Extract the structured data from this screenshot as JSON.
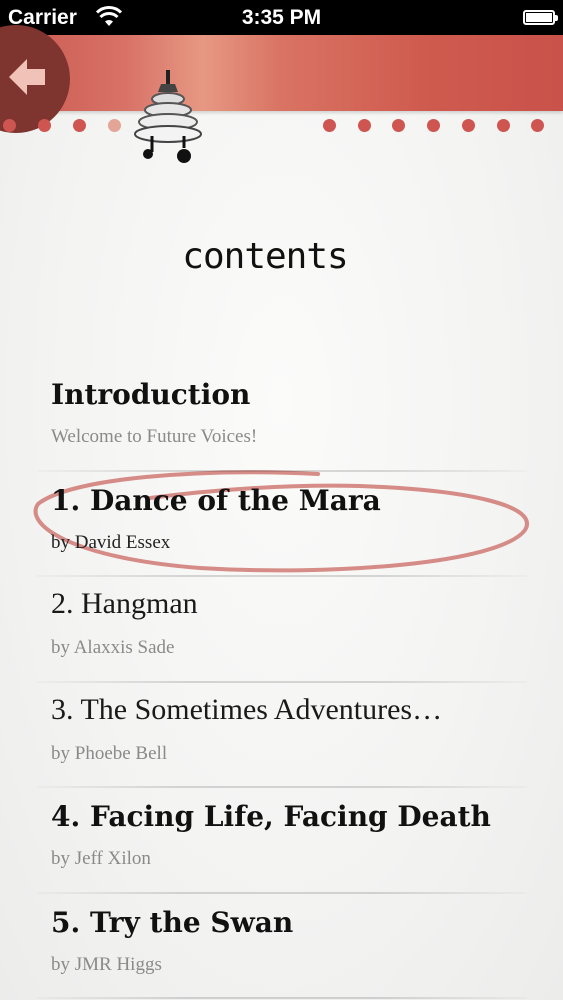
{
  "status_bar": {
    "carrier": "Carrier",
    "time": "3:35 PM",
    "wifi_icon": "wifi-icon",
    "battery_level": 1.0
  },
  "header": {
    "back_icon": "back-arrow-icon",
    "lamp_icon": "hanging-lamp-icon",
    "accent_color": "#cf5550"
  },
  "page": {
    "title": "contents"
  },
  "toc": {
    "items": [
      {
        "title": "Introduction",
        "subtitle": "Welcome to Future Voices!"
      },
      {
        "title": "1. Dance of the Mara",
        "subtitle": "by David Essex"
      },
      {
        "title": "2. Hangman",
        "subtitle": "by Alaxxis Sade"
      },
      {
        "title": "3. The Sometimes Adventures…",
        "subtitle": "by Phoebe Bell"
      },
      {
        "title": "4. Facing Life, Facing Death",
        "subtitle": "by Jeff Xilon"
      },
      {
        "title": "5. Try the Swan",
        "subtitle": "by JMR Higgs"
      }
    ]
  }
}
